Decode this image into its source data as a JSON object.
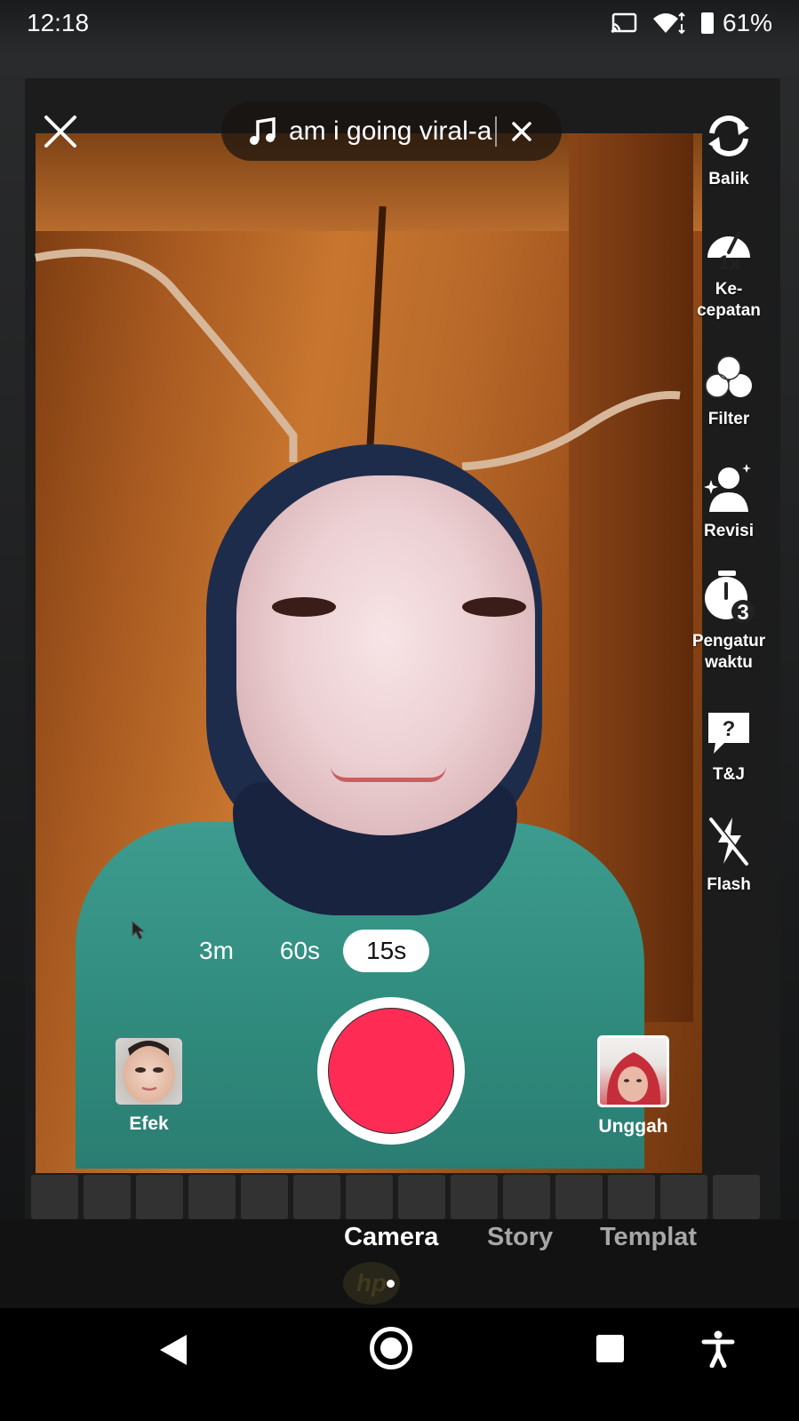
{
  "status_bar": {
    "time": "12:18",
    "battery": "61%",
    "icons": [
      "cast-icon",
      "wifi-icon",
      "battery-icon"
    ]
  },
  "top": {
    "close_icon": "close-icon",
    "sound_title": "am i going viral-a",
    "sound_icon": "music-note-icon",
    "sound_clear_icon": "close-icon"
  },
  "rail": [
    {
      "key": "flip",
      "label": "Balik",
      "icon": "flip-camera-icon"
    },
    {
      "key": "speed",
      "label": "Ke-\ncepatan",
      "icon": "speed-icon",
      "badge": "1x"
    },
    {
      "key": "filter",
      "label": "Filter",
      "icon": "filter-icon"
    },
    {
      "key": "beauty",
      "label": "Revisi",
      "icon": "beauty-icon"
    },
    {
      "key": "timer",
      "label": "Pengatur\nwaktu",
      "icon": "timer-icon",
      "badge": "3"
    },
    {
      "key": "qa",
      "label": "T&J",
      "icon": "question-icon",
      "badge": "?"
    },
    {
      "key": "flash",
      "label": "Flash",
      "icon": "flash-off-icon"
    }
  ],
  "durations": [
    {
      "label": "3m",
      "active": false
    },
    {
      "label": "60s",
      "active": false
    },
    {
      "label": "15s",
      "active": true
    }
  ],
  "effects_label": "Efek",
  "upload_label": "Unggah",
  "modes": [
    {
      "label": "Camera",
      "active": true
    },
    {
      "label": "Story",
      "active": false
    },
    {
      "label": "Templat",
      "active": false
    }
  ],
  "background_logo": "hp",
  "colors": {
    "record": "#fe2c55",
    "shirt": "#3d9c8f"
  }
}
